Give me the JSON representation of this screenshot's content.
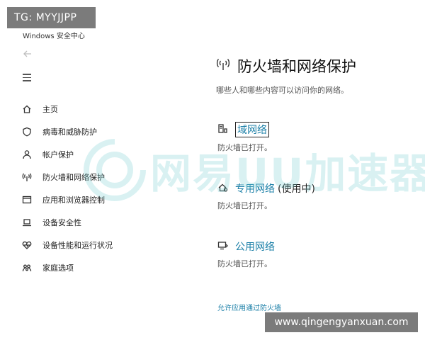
{
  "overlays": {
    "top_left": "TG: MYYJJPP",
    "bottom_right": "www.qingengyanxuan.com",
    "watermark_text": "网易UU加速器"
  },
  "window": {
    "title": "Windows 安全中心"
  },
  "sidebar": {
    "items": [
      {
        "label": "主页",
        "icon": "home-icon"
      },
      {
        "label": "病毒和威胁防护",
        "icon": "shield-icon"
      },
      {
        "label": "帐户保护",
        "icon": "person-icon"
      },
      {
        "label": "防火墙和网络保护",
        "icon": "wifi-signal-icon"
      },
      {
        "label": "应用和浏览器控制",
        "icon": "app-window-icon"
      },
      {
        "label": "设备安全性",
        "icon": "laptop-icon"
      },
      {
        "label": "设备性能和运行状况",
        "icon": "heart-icon"
      },
      {
        "label": "家庭选项",
        "icon": "family-icon"
      }
    ]
  },
  "main": {
    "title": "防火墙和网络保护",
    "subtitle": "哪些人和哪些内容可以访问你的网络。",
    "networks": [
      {
        "name": "域网络",
        "suffix": "",
        "status": "防火墙已打开。",
        "icon": "domain-network-icon"
      },
      {
        "name": "专用网络",
        "suffix": "(使用中)",
        "status": "防火墙已打开。",
        "icon": "private-network-icon"
      },
      {
        "name": "公用网络",
        "suffix": "",
        "status": "防火墙已打开。",
        "icon": "public-network-icon"
      }
    ],
    "allow_app_link": "允许应用通过防火墙"
  }
}
